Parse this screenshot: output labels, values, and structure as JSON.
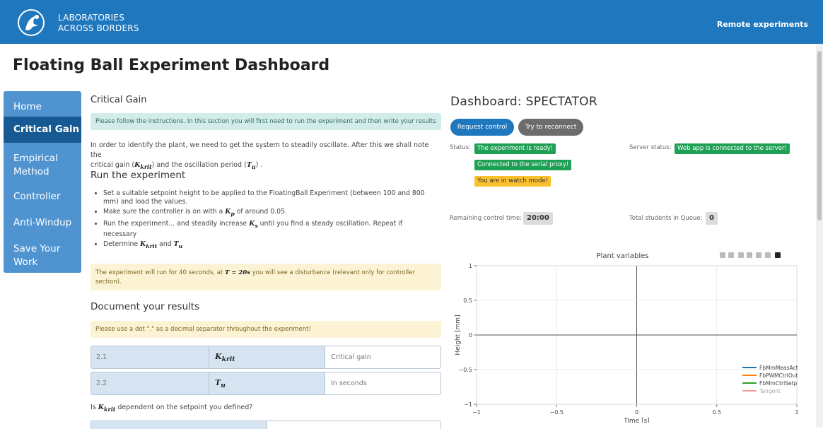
{
  "header": {
    "brand_line1": "LABORATORIES",
    "brand_line2": "ACROSS BORDERS",
    "nav_link": "Remote experiments",
    "bg_color": "#1f77be"
  },
  "page_title": "Floating Ball Experiment Dashboard",
  "sidebar": {
    "items": [
      {
        "label": "Home"
      },
      {
        "label": "Critical Gain",
        "active": true
      },
      {
        "label_l1": "Empirical",
        "label_l2": "Method"
      },
      {
        "label": "Controller"
      },
      {
        "label": "Anti-Windup"
      },
      {
        "label_l1": "Save Your",
        "label_l2": "Work"
      }
    ]
  },
  "section": {
    "title": "Critical Gain",
    "info_alert": "Please follow the instructions. In this section you will first need to run the experiment and then write your results",
    "intro_p1": "In order to identify the plant, we need to get the system to steadily oscillate. After this we shall note the",
    "intro_p2a": "critical gain (",
    "intro_kkrit": "K",
    "intro_kkrit_sub": "krit",
    "intro_p2b": ") and the oscillation period (",
    "intro_tu": "T",
    "intro_tu_sub": "u",
    "intro_p2c": ") .",
    "run_title": "Run the experiment",
    "bullets": {
      "b1_l1": "Set a suitable setpoint height to be applied to the FloatingBall Experiment (between 100 and 800",
      "b1_l2": "mm) and load the values.",
      "b2a": "Make sure the controller is on with a ",
      "b2_math": "K",
      "b2_sub": "p",
      "b2b": " of around 0.05.",
      "b3a": "Run the experiment... and steadily increase ",
      "b3_math": "K",
      "b3_sub": "s",
      "b3b": " until you find a steady oscillation. Repeat if",
      "b3_l2": "necessary",
      "b4a": "Determine ",
      "b4_m1": "K",
      "b4_m1_sub": "krit",
      "b4_and": " and ",
      "b4_m2": "T",
      "b4_m2_sub": "u"
    },
    "warn_alert_a": "The experiment will run for 40 seconds, at ",
    "warn_alert_math": "T = 20s",
    "warn_alert_b": " you will see a disturbance (relevant only for controller",
    "warn_alert_c": "section).",
    "doc_title": "Document your results",
    "decimal_alert": "Please use a dot \".\" as a decimal separator throughout the experiment!",
    "results": [
      {
        "id": "2.1",
        "symbol": "K",
        "sub": "krit",
        "desc": "Critical gain"
      },
      {
        "id": "2.2",
        "symbol": "T",
        "sub": "u",
        "desc": "In seconds"
      }
    ],
    "question_a": "Is ",
    "question_math": "K",
    "question_sub": "krit",
    "question_b": " dependent on the setpoint you defined?"
  },
  "dashboard": {
    "title": "Dashboard: SPECTATOR",
    "request_control": "Request control",
    "try_reconnect": "Try to reconnect",
    "status_label": "Status:",
    "status_badges": [
      "The experiment is ready!",
      "Connected to the serial proxy!",
      "You are in watch mode!"
    ],
    "server_status_label": "Server status:",
    "server_status_badge": "Web app is connected to the server!",
    "remaining_label": "Remaining control time:",
    "remaining_value": "20:00",
    "queue_label": "Total students in Queue:",
    "queue_value": "0"
  },
  "chart_data": {
    "type": "line",
    "title": "Plant variables",
    "xlabel": "Time [s]",
    "ylabel": "Height [mm]",
    "xlim": [
      -1,
      1
    ],
    "ylim": [
      -1,
      1
    ],
    "x_ticks": [
      "−1",
      "−0.5",
      "0",
      "0.5",
      "1"
    ],
    "y_ticks": [
      "1",
      "0.5",
      "0",
      "−0.5",
      "−1"
    ],
    "series": [
      {
        "name": "FbMmMeasAct",
        "color": "#1f77b4",
        "values": []
      },
      {
        "name": "FbPWMCtrlOut",
        "color": "#ff7f0e",
        "values": []
      },
      {
        "name": "FbMmCtrlSetp",
        "color": "#2ca02c",
        "values": []
      },
      {
        "name": "Tangent",
        "color": "#f2a0a0",
        "values": []
      }
    ],
    "legend_position": "bottom-right",
    "grid": true
  }
}
